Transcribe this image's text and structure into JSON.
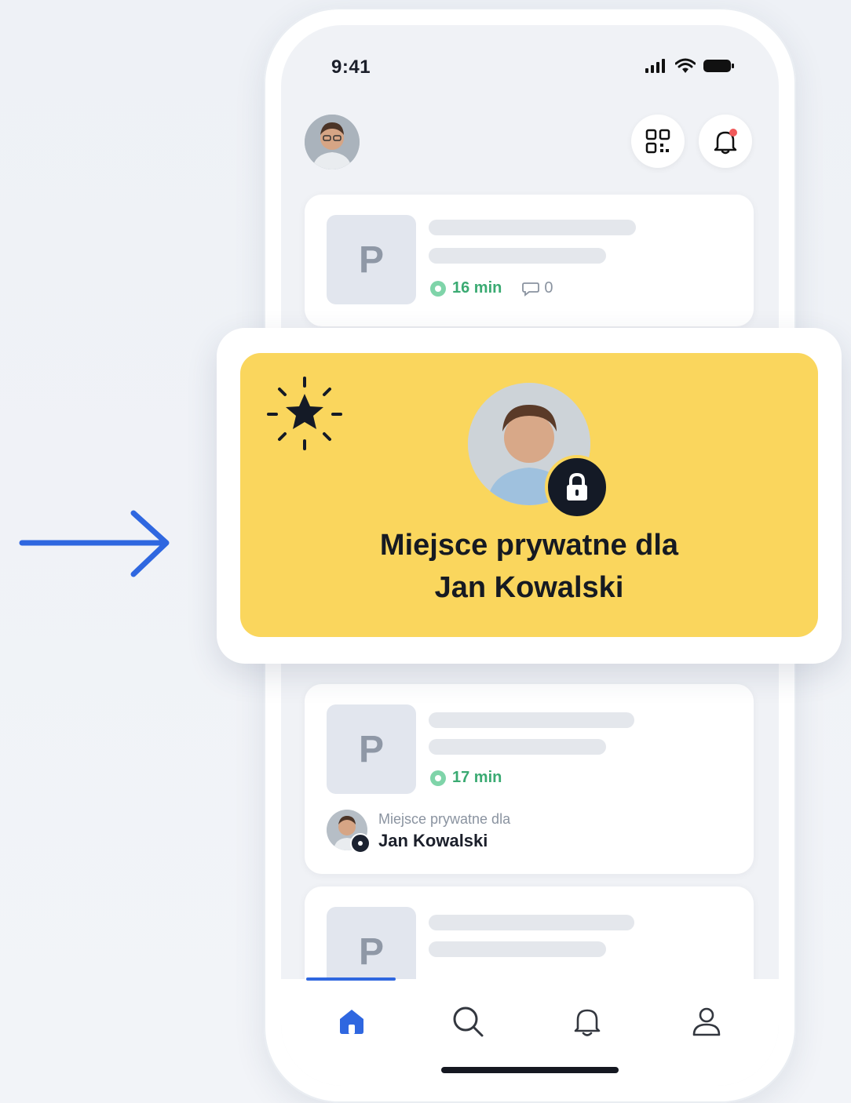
{
  "status_bar": {
    "time": "9:41"
  },
  "header": {
    "avatar_icon": "user-avatar-photo",
    "qr_icon": "qr-code-icon",
    "bell_icon": "bell-icon",
    "notification_dot_color": "#f0595a"
  },
  "feed": {
    "cards": [
      {
        "thumb_letter": "P",
        "duration": "16 min",
        "comments": "0"
      },
      {
        "thumb_letter": "P",
        "duration": "17 min",
        "owner_caption": "Miejsce prywatne dla",
        "owner_name": "Jan Kowalski"
      },
      {
        "thumb_letter": "P"
      }
    ]
  },
  "highlight": {
    "title_line1": "Miejsce prywatne dla",
    "title_line2": "Jan Kowalski",
    "background_color": "#fad65d",
    "icon": "sparkle-star-icon",
    "lock_icon": "lock-icon"
  },
  "tab_bar": {
    "active": "home",
    "tabs": [
      "home-icon",
      "search-icon",
      "bell-icon",
      "profile-icon"
    ],
    "active_color": "#2f67e0"
  },
  "annotation": {
    "icon": "arrow-right-icon",
    "color": "#2f67e0"
  }
}
